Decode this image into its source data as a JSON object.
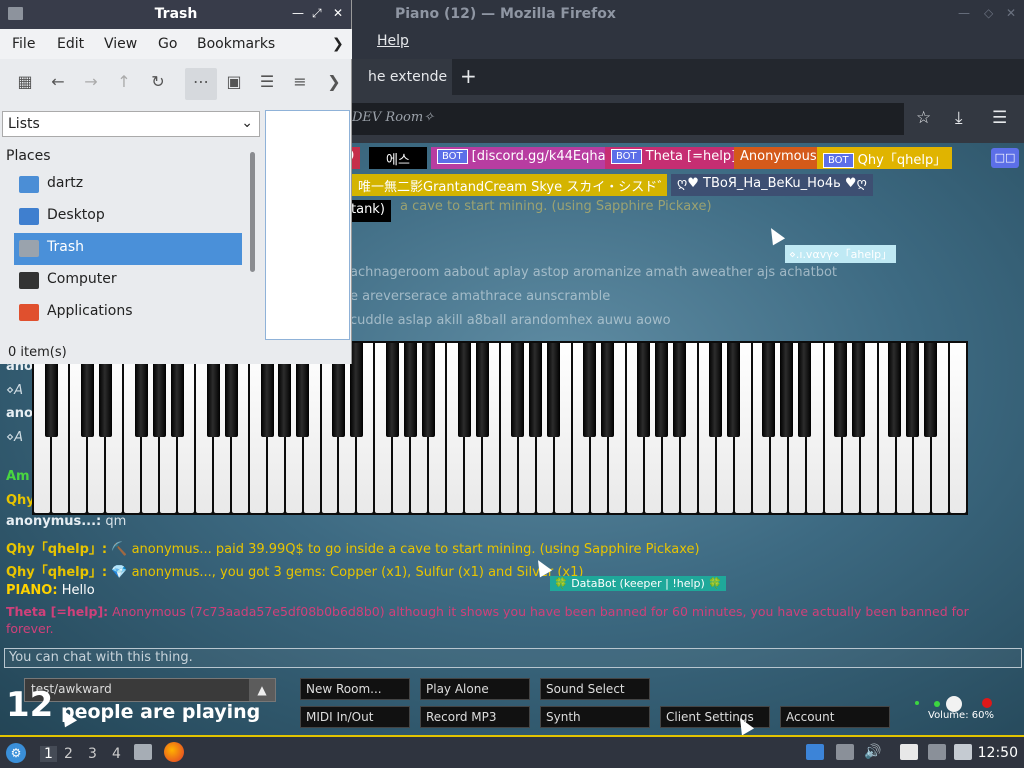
{
  "firefox": {
    "title": "Piano (12) — Mozilla Firefox",
    "menu_help": "Help",
    "tab_label": "he extende",
    "new_tab": "+",
    "url": "DEV Room✧"
  },
  "nametags": [
    {
      "label": "9",
      "bot": "",
      "bg": "#c62e4a"
    },
    {
      "label": "에스",
      "bot": "",
      "bg": "#000000"
    },
    {
      "label": "[discord.gg/k44Eqha]",
      "bot": "BOT",
      "bg": "#b83da1"
    },
    {
      "label": "Theta [=help]",
      "bot": "BOT",
      "bg": "#c62e72"
    },
    {
      "label": "Anonymous",
      "bot": "",
      "bg": "#d45a1a"
    },
    {
      "label": "Qhy「qhelp」",
      "bot": "BOT",
      "bg": "#e0b400"
    },
    {
      "label": "唯一無二影GrantandCream Skye スカイ・シスド゛⑧圏",
      "bot": "",
      "bg": "#d4b400"
    },
    {
      "label": "ღ♥ TBoЯ_Ha_BeKu_Ho4ь ♥ღ",
      "bot": "",
      "bg": "#3d4f72"
    },
    {
      "label": "tank)",
      "bot": "",
      "bg": "#000000"
    }
  ],
  "faded_lines": [
    "a cave to start mining. (using Sapphire Pickaxe)",
    "achnageroom aabout aplay astop aromanize amath aweather ajs achatbot",
    "e areverserace amathrace aunscramble",
    "cuddle aslap akill a8ball arandomhex auwu aowo"
  ],
  "cursor_tag": "⋄.ı.vαvγ⋄「ahelp」",
  "left_fragments": [
    "ano",
    "⋄A",
    "ano",
    "⋄A",
    "Am",
    "Qhy"
  ],
  "chat": [
    {
      "name": "anonymus...:",
      "text": "qm",
      "name_color": "#e6eef3",
      "text_color": "#d8e2e8"
    },
    {
      "name": "Qhy「qhelp」:",
      "text": "⛏️ anonymus... paid 39.99Q$ to go inside a cave to start mining. (using Sapphire Pickaxe)",
      "name_color": "#e8c400",
      "text_color": "#e8c400"
    },
    {
      "name": "Qhy「qhelp」:",
      "text": "💎 anonymus..., you got 3 gems: Copper (x1), Sulfur (x1) and Silver (x1)",
      "name_color": "#e8c400",
      "text_color": "#e8c400"
    },
    {
      "name": "PIANO:",
      "text": "Hello",
      "name_color": "#ffd200",
      "text_color": "#ffffff"
    },
    {
      "name": "Theta [=help]:",
      "text": "Anonymous (7c73aada57e5df08b0b6d8b0) although it shows you have been banned for 60 minutes, you have actually been banned for",
      "name_color": "#d0407a",
      "text_color": "#d0407a"
    }
  ],
  "chat_wrap": "forever.",
  "databot_tag": "🍀 DataBot (keeper | !help) 🍀",
  "chat_placeholder": "You can chat with this thing.",
  "room_select": "test/awkward",
  "player_count": "12",
  "player_text": "people are playing",
  "buttons": {
    "new_room": "New Room...",
    "play_alone": "Play Alone",
    "sound_select": "Sound Select",
    "midi": "MIDI In/Out",
    "record_mp3": "Record MP3",
    "synth": "Synth",
    "client_settings": "Client Settings",
    "account": "Account"
  },
  "volume_label": "Volume: 60%",
  "file_manager": {
    "title": "Trash",
    "menu": [
      "File",
      "Edit",
      "View",
      "Go",
      "Bookmarks"
    ],
    "panel_select": "Lists",
    "places_title": "Places",
    "places": [
      {
        "label": "dartz",
        "icon": "home-folder-icon",
        "color": "#4b8ed6"
      },
      {
        "label": "Desktop",
        "icon": "desktop-icon",
        "color": "#3f7fcf"
      },
      {
        "label": "Trash",
        "icon": "trash-icon",
        "color": "#9aa3ad"
      },
      {
        "label": "Computer",
        "icon": "computer-icon",
        "color": "#333333"
      },
      {
        "label": "Applications",
        "icon": "applications-icon",
        "color": "#e0502e"
      }
    ],
    "status": "0 item(s)"
  },
  "taskbar": {
    "workspaces": [
      "1",
      "2",
      "3",
      "4"
    ],
    "clock": "12:50"
  },
  "colors": {
    "accent": "#4a90d9",
    "taskbar_border": "#e2c400"
  }
}
